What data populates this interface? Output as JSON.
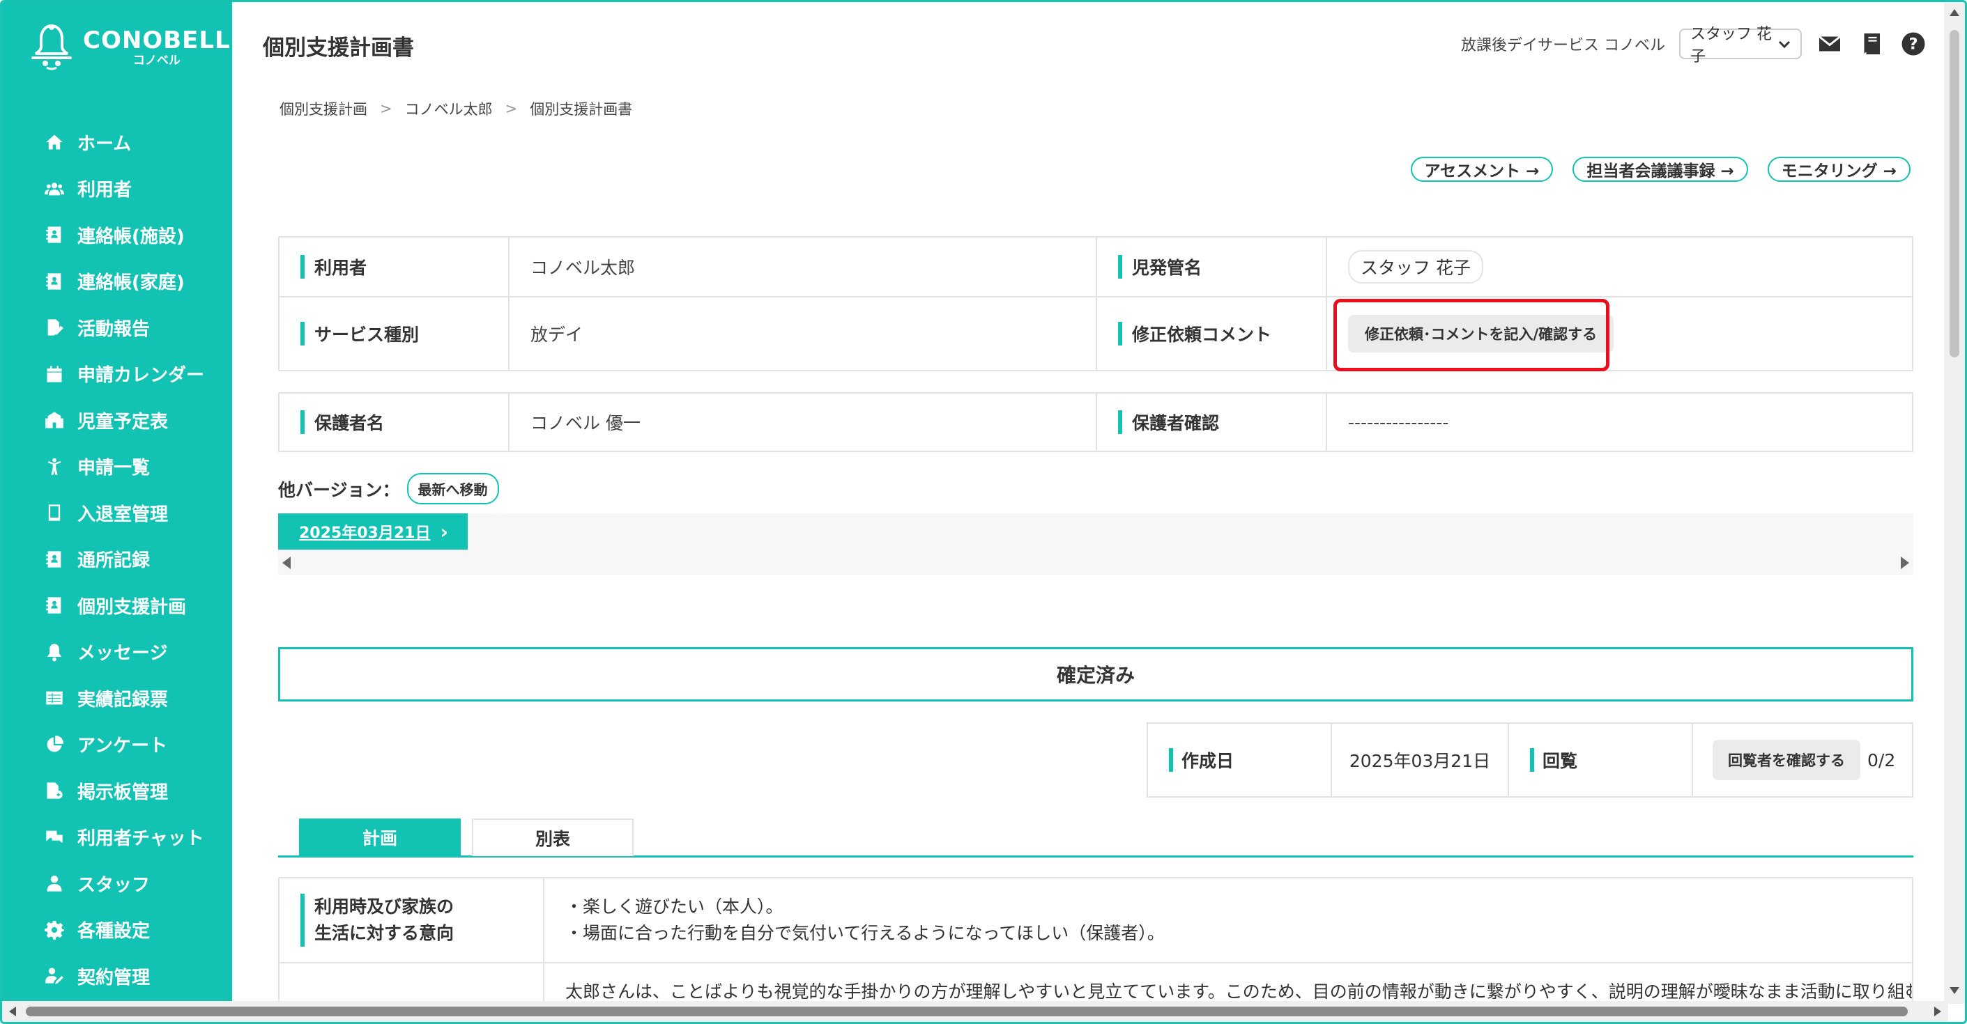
{
  "app": {
    "logo_en": "CONOBELL",
    "logo_jp": "コノベル",
    "accent_color": "#12c3b4",
    "highlight_color": "#e8101c"
  },
  "sidebar": {
    "items": [
      {
        "label": "ホーム",
        "icon": "home-icon"
      },
      {
        "label": "利用者",
        "icon": "users-icon"
      },
      {
        "label": "連絡帳(施設)",
        "icon": "contact-book-icon"
      },
      {
        "label": "連絡帳(家庭)",
        "icon": "contact-book-icon"
      },
      {
        "label": "活動報告",
        "icon": "report-edit-icon"
      },
      {
        "label": "申請カレンダー",
        "icon": "calendar-icon"
      },
      {
        "label": "児童予定表",
        "icon": "school-icon"
      },
      {
        "label": "申請一覧",
        "icon": "child-icon"
      },
      {
        "label": "入退室管理",
        "icon": "tablet-icon"
      },
      {
        "label": "通所記録",
        "icon": "contact-book-icon"
      },
      {
        "label": "個別支援計画",
        "icon": "contact-book-icon"
      },
      {
        "label": "メッセージ",
        "icon": "bell-icon"
      },
      {
        "label": "実績記録票",
        "icon": "table-icon"
      },
      {
        "label": "アンケート",
        "icon": "pie-chart-icon"
      },
      {
        "label": "掲示板管理",
        "icon": "bulletin-icon"
      },
      {
        "label": "利用者チャット",
        "icon": "chat-icon"
      },
      {
        "label": "スタッフ",
        "icon": "staff-icon"
      },
      {
        "label": "各種設定",
        "icon": "gear-icon"
      },
      {
        "label": "契約管理",
        "icon": "contract-icon"
      }
    ]
  },
  "header": {
    "title": "個別支援計画書",
    "facility": "放課後デイサービス コノベル",
    "staff_select": "スタッフ 花子"
  },
  "breadcrumb": [
    "個別支援計画",
    "コノベル太郎",
    "個別支援計画書"
  ],
  "top_links": [
    "アセスメント →",
    "担当者会議議事録 →",
    "モニタリング →"
  ],
  "info": {
    "user_label": "利用者",
    "user_value": "コノベル太郎",
    "manager_label": "児発管名",
    "manager_value": "スタッフ 花子",
    "service_label": "サービス種別",
    "service_value": "放デイ",
    "comment_label": "修正依頼コメント",
    "comment_button": "修正依頼･コメントを記入/確認する",
    "guardian_label": "保護者名",
    "guardian_value": "コノベル 優一",
    "guardian_confirm_label": "保護者確認",
    "guardian_confirm_value": "----------------"
  },
  "versions": {
    "label": "他バージョン：",
    "latest_button": "最新へ移動",
    "current": "2025年03月21日"
  },
  "status": "確定済み",
  "meta": {
    "created_label": "作成日",
    "created_value": "2025年03月21日",
    "circulation_label": "回覧",
    "viewer_button": "回覧者を確認する",
    "viewer_count": "0/2"
  },
  "tabs": [
    "計画",
    "別表"
  ],
  "plan": {
    "rows": [
      {
        "label_line1": "利用時及び家族の",
        "label_line2": "生活に対する意向",
        "line1": "・楽しく遊びたい（本人）。",
        "line2": "・場面に合った行動を自分で気付いて行えるようになってほしい（保護者）。"
      },
      {
        "line1": "太郎さんは、ことばよりも視覚的な手掛かりの方が理解しやすいと見立てています。このため、目の前の情報が動きに繋がりやすく、説明の理解が曖昧なまま活動に取り組む様子が見られ、集"
      }
    ]
  }
}
